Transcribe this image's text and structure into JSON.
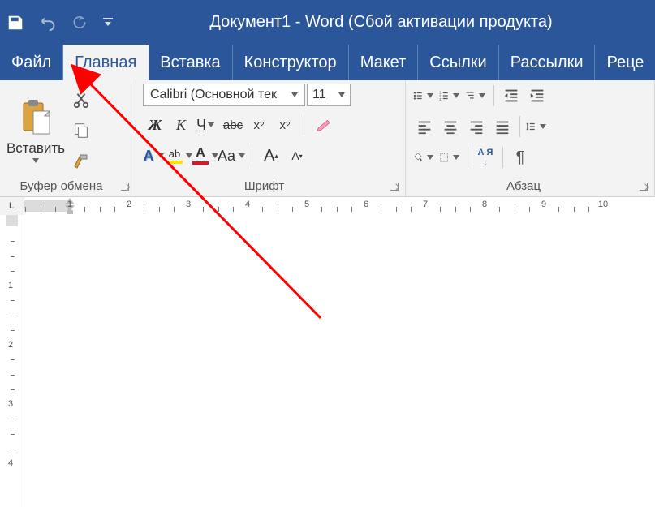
{
  "title": "Документ1  -  Word (Сбой активации продукта)",
  "tabs": [
    "Файл",
    "Главная",
    "Вставка",
    "Конструктор",
    "Макет",
    "Ссылки",
    "Рассылки",
    "Реце"
  ],
  "active_tab_index": 1,
  "clipboard": {
    "paste": "Вставить",
    "label": "Буфер обмена"
  },
  "font": {
    "name": "Calibri (Основной тек",
    "size": "11",
    "bold": "Ж",
    "italic": "К",
    "underline": "Ч",
    "strike": "abc",
    "subscript": "x",
    "superscript": "x",
    "case": "Aa",
    "grow": "A",
    "shrink": "A",
    "fontcolor_letter": "A",
    "highlight_letter": "ab",
    "textfx_letter": "A",
    "label": "Шрифт"
  },
  "paragraph": {
    "sort": "А Я",
    "pilcrow": "¶",
    "label": "Абзац"
  },
  "ruler": {
    "corner": "L",
    "numbers": [
      1,
      2,
      3,
      4,
      5,
      6,
      7,
      8,
      9,
      10
    ],
    "vnumbers": [
      1,
      2,
      3,
      4
    ]
  },
  "colors": {
    "brand": "#2b579a",
    "highlight": "#ffe600",
    "fontcolor": "#e81123"
  }
}
